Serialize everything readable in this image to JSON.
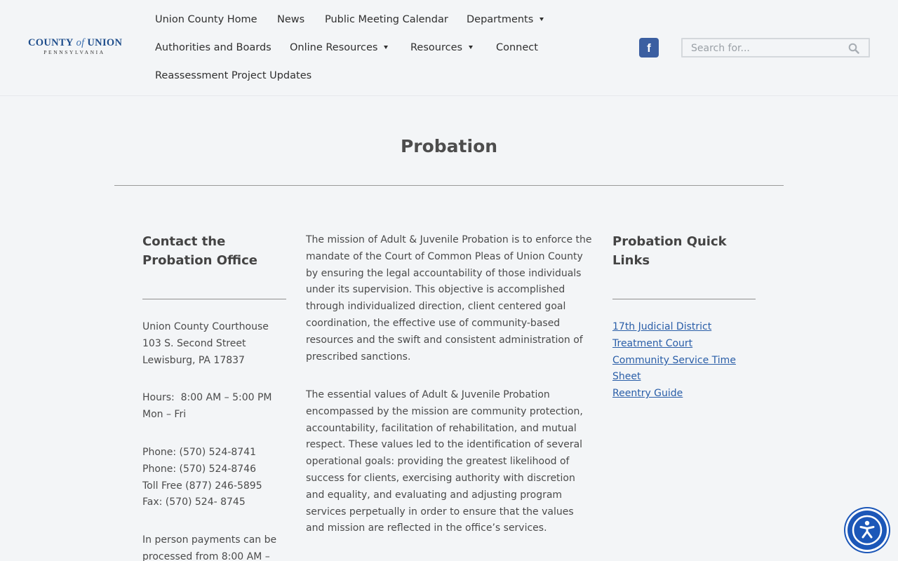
{
  "header": {
    "logo": {
      "line1_a": "County",
      "line1_of": "of",
      "line1_b": "Union",
      "line2": "PENNSYLVANIA"
    },
    "nav": [
      {
        "label": "Union County Home",
        "dropdown": false
      },
      {
        "label": "News",
        "dropdown": false
      },
      {
        "label": "Public Meeting Calendar",
        "dropdown": false
      },
      {
        "label": "Departments",
        "dropdown": true
      },
      {
        "label": "Authorities and Boards",
        "dropdown": false
      },
      {
        "label": "Online Resources",
        "dropdown": true
      },
      {
        "label": "Resources",
        "dropdown": true
      },
      {
        "label": "Connect",
        "dropdown": false
      },
      {
        "label": "Reassessment Project Updates",
        "dropdown": false
      }
    ],
    "facebook_icon": "facebook-icon",
    "search": {
      "placeholder": "Search for...",
      "value": "",
      "icon": "search-icon"
    }
  },
  "page": {
    "title": "Probation"
  },
  "contact": {
    "heading_line1": "Contact the",
    "heading_line2": "Probation Office",
    "address": [
      "Union County Courthouse",
      "103 S. Second Street",
      "Lewisburg, PA 17837"
    ],
    "hours": [
      "Hours:  8:00 AM – 5:00 PM",
      "Mon – Fri"
    ],
    "phones": [
      "Phone: (570) 524-8741",
      "Phone: (570) 524-8746",
      "Toll Free (877) 246-5895",
      "Fax: (570) 524- 8745"
    ],
    "payments": [
      "In person payments can be",
      "processed from 8:00 AM –"
    ]
  },
  "mission": {
    "para1": "The mission of Adult & Juvenile Probation is to enforce the mandate of the Court of Common Pleas of Union County by ensuring the legal accountability of those individuals under its supervision. This objective is accomplished through individualized direction, client centered goal coordination, the effective use of community-based resources and the swift and consistent administration of prescribed sanctions.",
    "para2": "The essential values of Adult & Juvenile Probation encompassed by the mission are community protection, accountability, facilitation of rehabilitation, and mutual respect. These values led to the identification of several operational goals: providing the greatest likelihood of success for clients, exercising authority with discretion and equality, and evaluating and adjusting program services perpetually in order to ensure that the values and mission are reflected in the office’s services."
  },
  "quick_links": {
    "heading_line1": "Probation Quick",
    "heading_line2": "Links",
    "links": [
      {
        "line1": "17th Judicial District",
        "line2": ""
      },
      {
        "line1": "Treatment Court",
        "line2": ""
      },
      {
        "line1": "Community Service Time",
        "line2": "Sheet"
      },
      {
        "line1": "Reentry Guide",
        "line2": ""
      }
    ]
  },
  "accessibility": {
    "icon": "accessibility-icon"
  },
  "colors": {
    "brand_blue": "#1f4e8c",
    "link": "#2a5ea8",
    "facebook": "#3b5fa1",
    "a11y": "#1c57b8"
  }
}
